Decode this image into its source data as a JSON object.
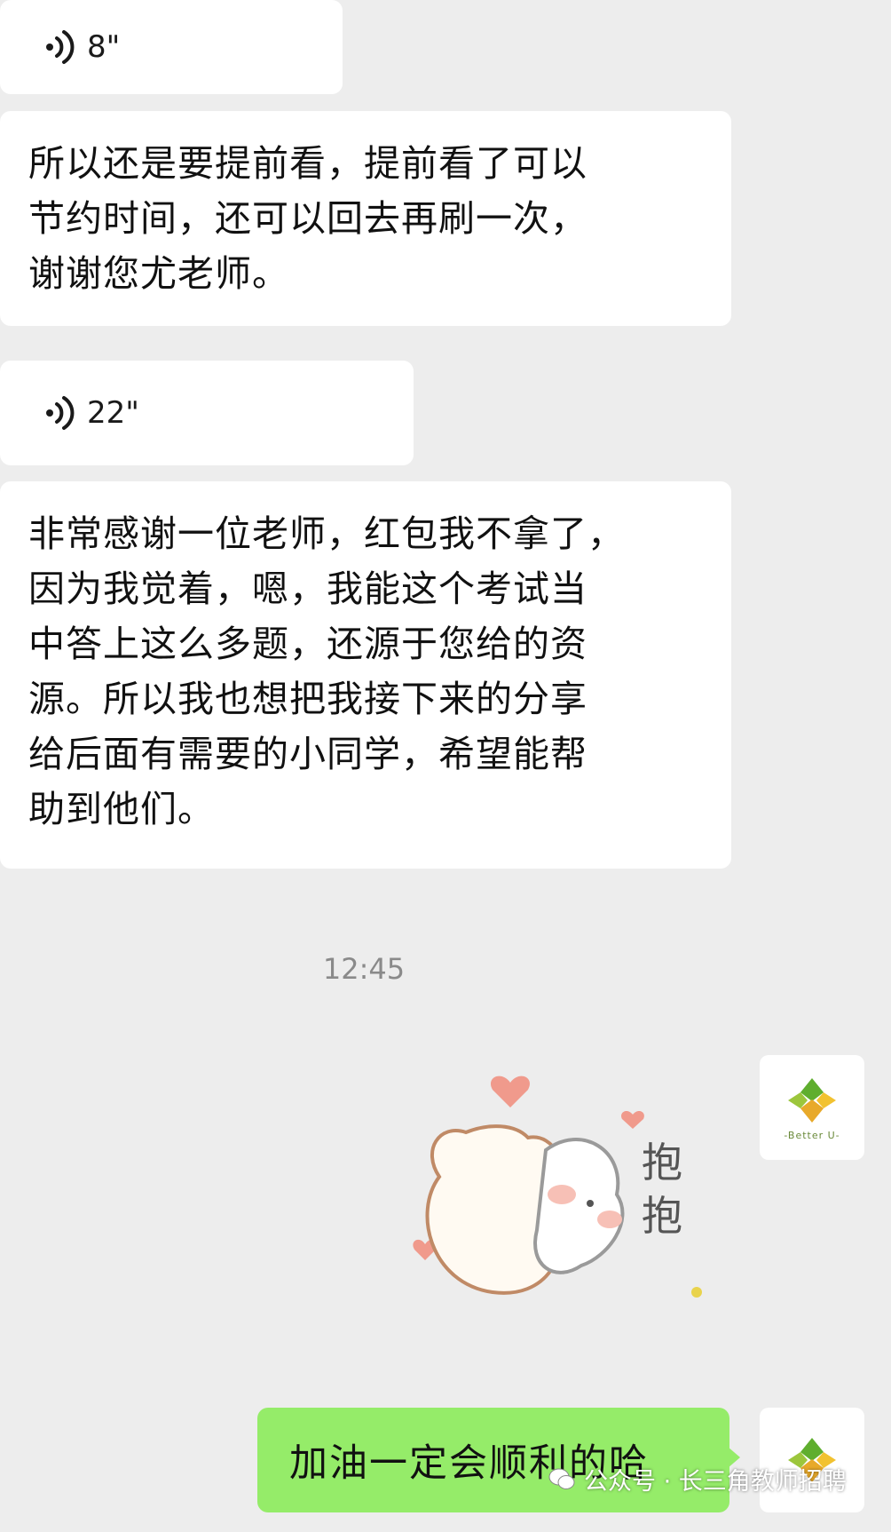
{
  "messages": {
    "voice_1": {
      "duration": "8\""
    },
    "text_1": "所以还是要提前看，提前看了可以\n节约时间，还可以回去再刷一次，\n谢谢您尤老师。",
    "voice_2": {
      "duration": "22\""
    },
    "text_2": "非常感谢一位老师，红包我不拿了，\n因为我觉着，嗯，我能这个考试当\n中答上这么多题，还源于您给的资\n源。所以我也想把我接下来的分享\n给后面有需要的小同学，希望能帮\n助到他们。"
  },
  "timestamp": "12:45",
  "sticker": {
    "text": "抱抱",
    "icon": "hug-sticker"
  },
  "sent": {
    "text": "加油一定会顺利的哈"
  },
  "avatar": {
    "brand": "-Better U-",
    "icon": "better-u-logo"
  },
  "watermark": {
    "text": "公众号 · 长三角教师招聘",
    "icon": "wechat-icon"
  },
  "colors": {
    "background": "#ededed",
    "sent_bubble": "#95ec69",
    "received_bubble": "#ffffff"
  }
}
